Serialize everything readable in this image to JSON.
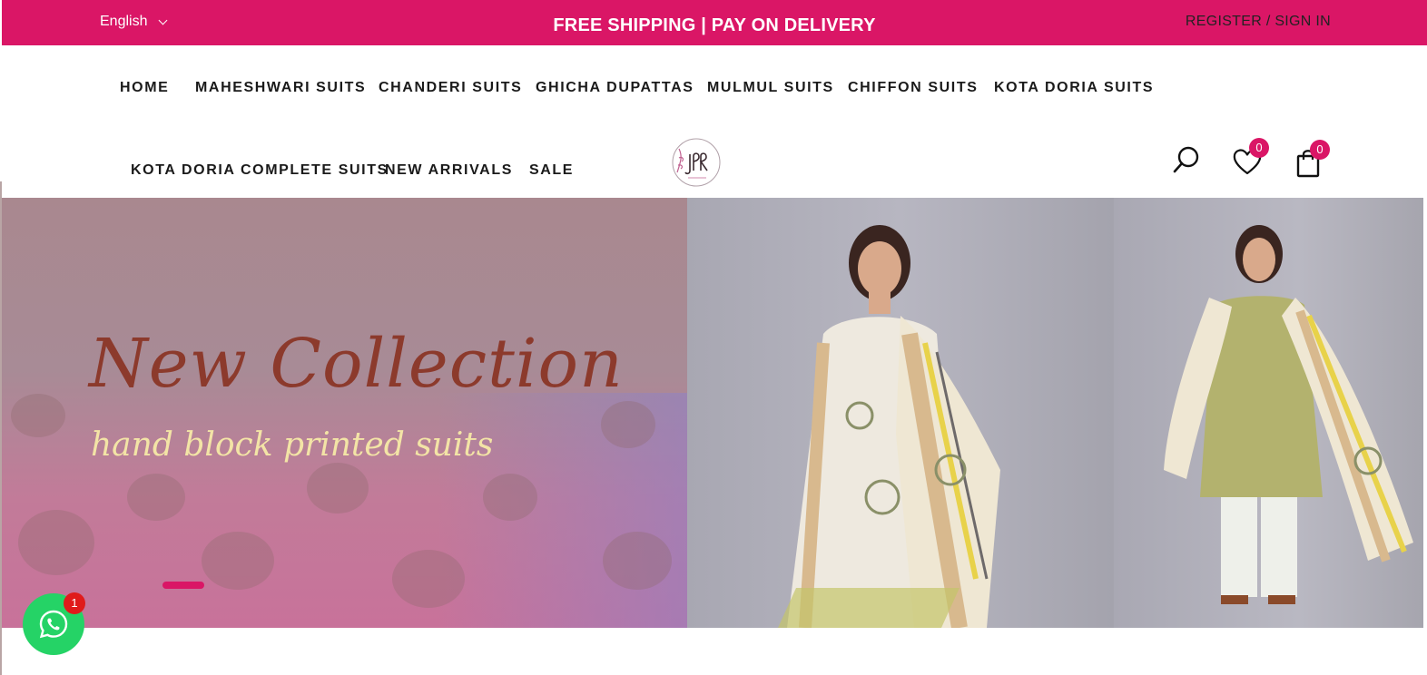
{
  "topbar": {
    "language": "English",
    "promo": "FREE SHIPPING | PAY ON DELIVERY",
    "register": "REGISTER",
    "separator": " / ",
    "signin": "SIGN IN",
    "bg_color": "#da1666"
  },
  "nav": {
    "items": [
      "HOME",
      "MAHESHWARI SUITS",
      "CHANDERI SUITS",
      "GHICHA DUPATTAS",
      "MULMUL SUITS",
      "CHIFFON SUITS",
      "KOTA DORIA SUITS",
      "KOTA DORIA COMPLETE SUITS",
      "NEW ARRIVALS",
      "SALE"
    ]
  },
  "header_icons": {
    "search": "search-icon",
    "wishlist": "heart-icon",
    "cart": "shopping-bag-icon",
    "wishlist_count": "0",
    "cart_count": "0"
  },
  "hero": {
    "title": "New Collection",
    "subtitle": "hand block printed  suits"
  },
  "whatsapp": {
    "icon": "whatsapp-icon",
    "count": "1"
  }
}
